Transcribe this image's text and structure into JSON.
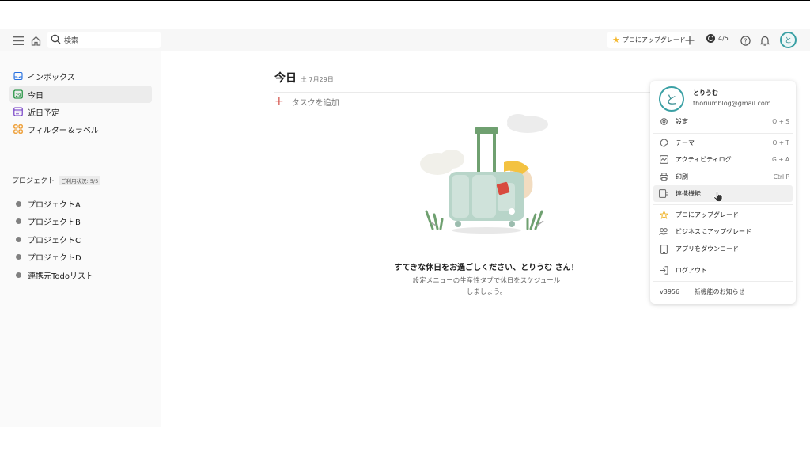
{
  "topbar": {
    "search_label": "検索",
    "upgrade_label": "プロにアップグレード",
    "karma_text": "4/5",
    "avatar_letter": "と"
  },
  "sidebar": {
    "nav": [
      {
        "label": "インボックス",
        "icon": "inbox-icon"
      },
      {
        "label": "今日",
        "icon": "calendar-today-icon",
        "day": "29"
      },
      {
        "label": "近日予定",
        "icon": "calendar-upcoming-icon"
      },
      {
        "label": "フィルター＆ラベル",
        "icon": "filters-labels-icon"
      }
    ],
    "projects_heading": "プロジェクト",
    "projects_usage": "ご利用状況: 5/5",
    "projects": [
      "プロジェクトA",
      "プロジェクトB",
      "プロジェクトC",
      "プロジェクトD",
      "連携元Todoリスト"
    ]
  },
  "main": {
    "title": "今日",
    "date": "土 7月29日",
    "add_task": "タスクを追加",
    "empty_title": "すてきな休日をお過ごしください、とりうむ さん！",
    "empty_desc": "設定メニューの生産性タブで休日をスケジュールしましょう。"
  },
  "menu": {
    "avatar_letter": "と",
    "user_name": "とりうむ",
    "email": "thoriumblog@gmail.com",
    "items": [
      {
        "label": "設定",
        "shortcut": "O + S",
        "icon": "gear-icon"
      },
      {
        "label": "テーマ",
        "shortcut": "O + T",
        "icon": "palette-icon"
      },
      {
        "label": "アクティビティログ",
        "shortcut": "G + A",
        "icon": "activity-icon"
      },
      {
        "label": "印刷",
        "shortcut": "Ctrl P",
        "icon": "printer-icon"
      },
      {
        "label": "連携機能",
        "shortcut": "",
        "icon": "integrations-icon"
      },
      {
        "label": "プロにアップグレード",
        "shortcut": "",
        "icon": "star-icon"
      },
      {
        "label": "ビジネスにアップグレード",
        "shortcut": "",
        "icon": "team-icon"
      },
      {
        "label": "アプリをダウンロード",
        "shortcut": "",
        "icon": "download-app-icon"
      },
      {
        "label": "ログアウト",
        "shortcut": "",
        "icon": "logout-icon"
      }
    ],
    "version": "v3956",
    "whats_new": "新機能のお知らせ"
  },
  "colors": {
    "accent_red": "#d1453b",
    "avatar_teal": "#3aa0a4",
    "star_yellow": "#f5b82e"
  }
}
